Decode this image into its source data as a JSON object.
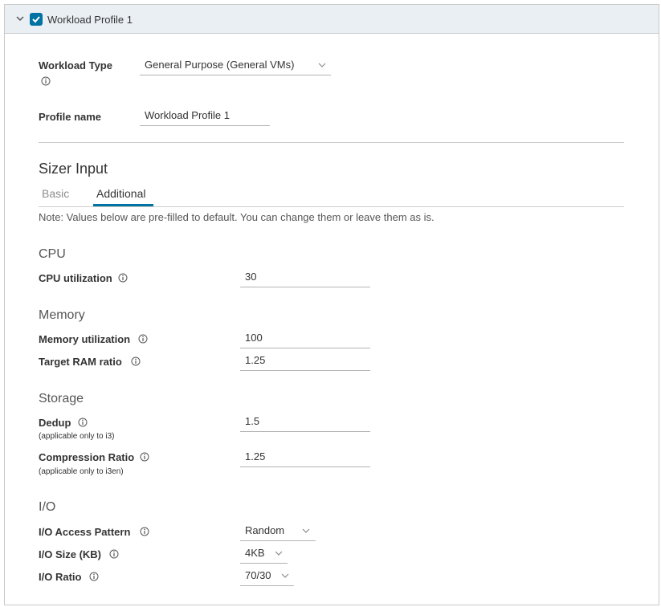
{
  "header": {
    "title": "Workload Profile 1",
    "checked": true
  },
  "workload_type": {
    "label": "Workload Type",
    "value": "General Purpose (General VMs)"
  },
  "profile_name": {
    "label": "Profile name",
    "value": "Workload Profile 1"
  },
  "sizer": {
    "title": "Sizer Input",
    "tabs": [
      {
        "label": "Basic",
        "active": false
      },
      {
        "label": "Additional",
        "active": true
      }
    ],
    "note": "Note: Values below are pre-filled to default. You can change them or leave them as is."
  },
  "cpu": {
    "heading": "CPU",
    "utilization": {
      "label": "CPU utilization",
      "value": "30"
    }
  },
  "memory": {
    "heading": "Memory",
    "utilization": {
      "label": "Memory utilization",
      "value": "100"
    },
    "ram_ratio": {
      "label": "Target RAM ratio",
      "value": "1.25"
    }
  },
  "storage": {
    "heading": "Storage",
    "dedup": {
      "label": "Dedup",
      "sublabel": "(applicable only to i3)",
      "value": "1.5"
    },
    "compression": {
      "label": "Compression Ratio",
      "sublabel": "(applicable only to i3en)",
      "value": "1.25"
    }
  },
  "io": {
    "heading": "I/O",
    "access_pattern": {
      "label": "I/O Access Pattern",
      "value": "Random"
    },
    "size": {
      "label": "I/O Size (KB)",
      "value": "4KB"
    },
    "ratio": {
      "label": "I/O Ratio",
      "value": "70/30"
    }
  },
  "colors": {
    "accent": "#0072a3",
    "header_bg": "#eaeff3"
  }
}
